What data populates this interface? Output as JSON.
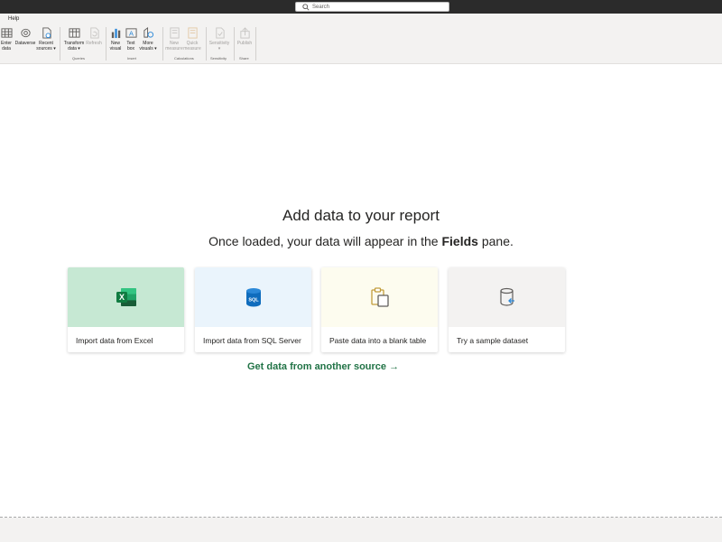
{
  "titlebar": {
    "search_placeholder": "Search"
  },
  "menu": {
    "help": "Help"
  },
  "ribbon": {
    "buttons": [
      {
        "label": "Enter\ndata",
        "icon": "table-icon"
      },
      {
        "label": "Dataverse",
        "icon": "dataverse-icon"
      },
      {
        "label": "Recent\nsources ▾",
        "icon": "recent-sources-icon"
      },
      {
        "label": "Transform\ndata ▾",
        "icon": "transform-data-icon"
      },
      {
        "label": "Refresh",
        "icon": "refresh-icon"
      },
      {
        "label": "New\nvisual",
        "icon": "bar-chart-icon"
      },
      {
        "label": "Text\nbox",
        "icon": "text-box-icon"
      },
      {
        "label": "More\nvisuals ▾",
        "icon": "more-visuals-icon"
      },
      {
        "label": "New\nmeasure",
        "icon": "new-measure-icon"
      },
      {
        "label": "Quick\nmeasure",
        "icon": "quick-measure-icon"
      },
      {
        "label": "Sensitivity\n▾",
        "icon": "sensitivity-icon"
      },
      {
        "label": "Publish",
        "icon": "publish-icon"
      }
    ],
    "groups": [
      "Queries",
      "Insert",
      "Calculations",
      "Sensitivity",
      "Share"
    ]
  },
  "main": {
    "title": "Add data to your report",
    "subtitle_before": "Once loaded, your data will appear in the ",
    "subtitle_bold": "Fields",
    "subtitle_after": " pane.",
    "cards": [
      {
        "label": "Import data from Excel",
        "icon": "excel-icon",
        "color": "#c6e8d3"
      },
      {
        "label": "Import data from SQL Server",
        "icon": "sql-server-icon",
        "color": "#eaf4fc"
      },
      {
        "label": "Paste data into a blank table",
        "icon": "paste-icon",
        "color": "#fdfcef"
      },
      {
        "label": "Try a sample dataset",
        "icon": "sample-dataset-icon",
        "color": "#f3f2f1"
      }
    ],
    "another_source": "Get data from another source →"
  },
  "colors": {
    "accent": "#217346",
    "ribbon_bg": "#f3f2f1",
    "titlebar_bg": "#2b2b2b"
  }
}
